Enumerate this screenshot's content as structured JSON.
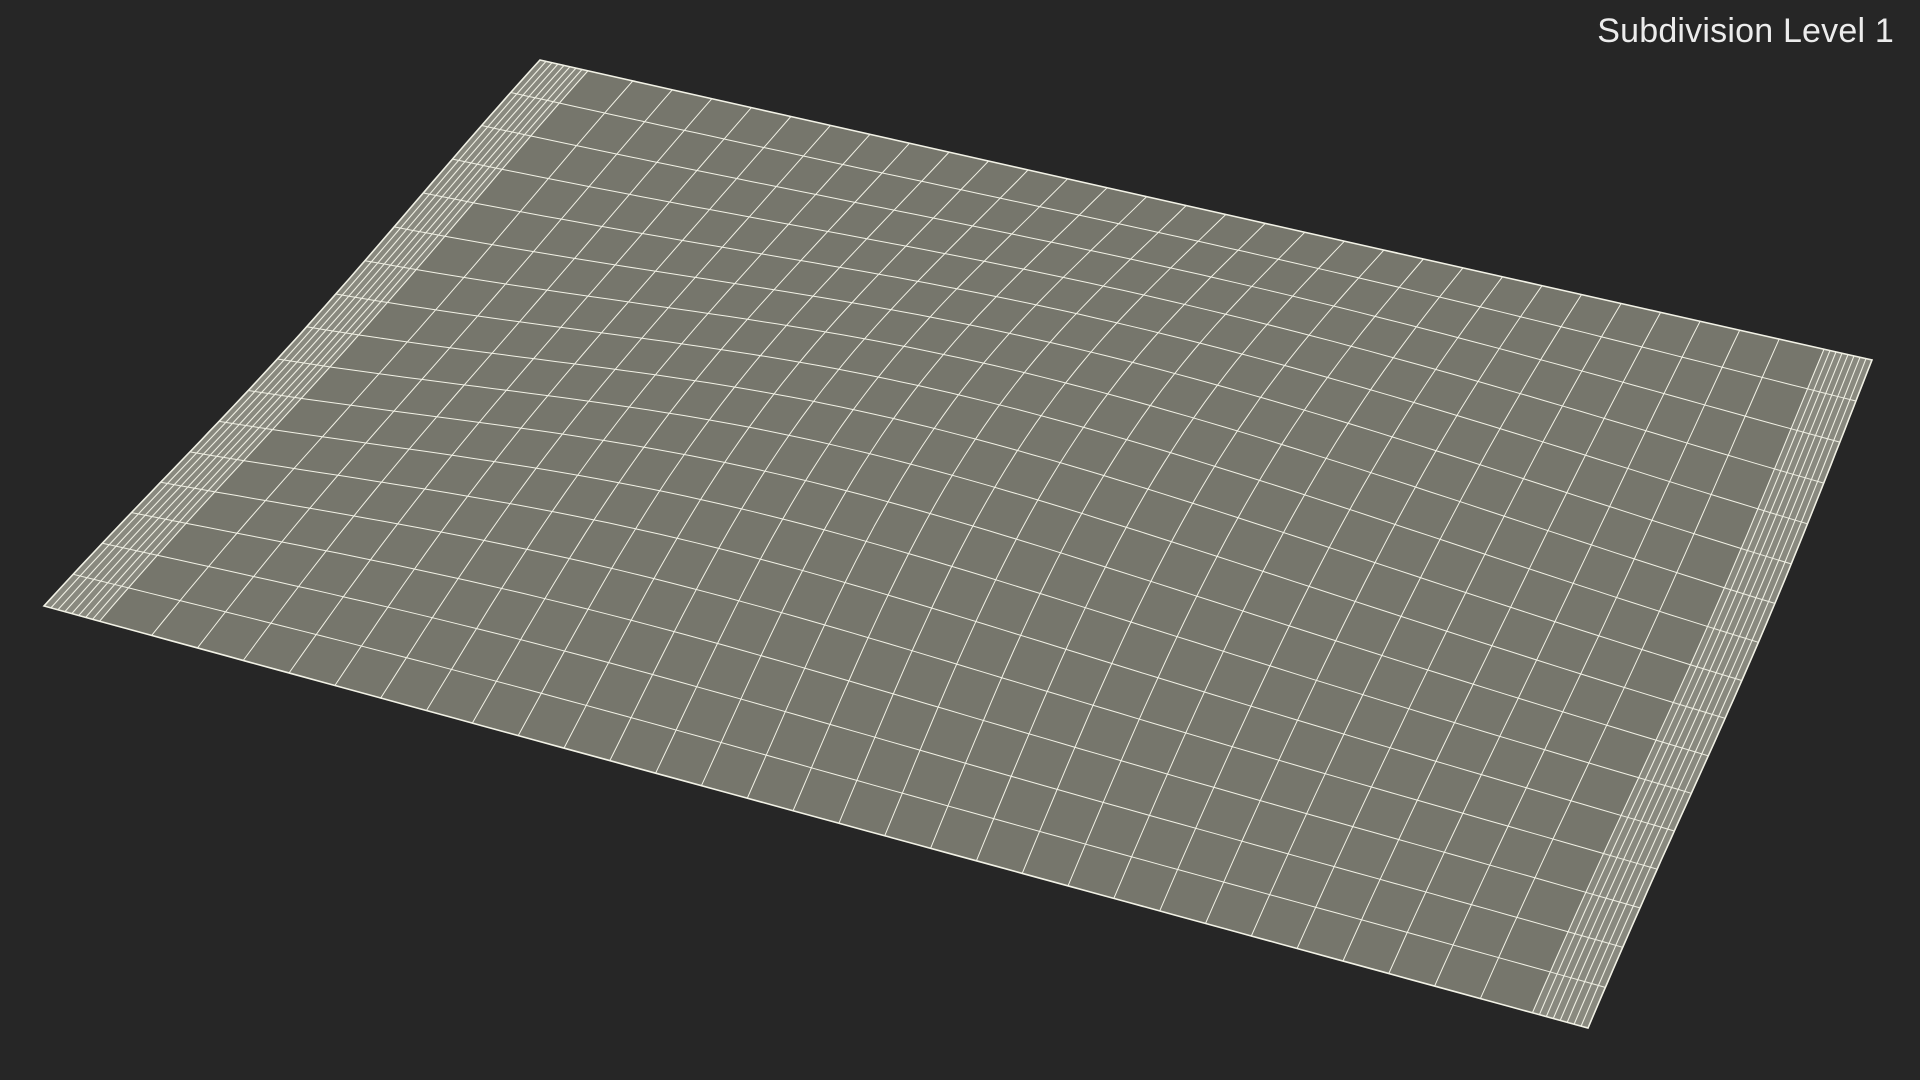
{
  "viewport": {
    "label": "Subdivision Level 1",
    "background_color": "#262626",
    "surface_color": "#76766c",
    "wire_color": "#f2f2e6"
  }
}
